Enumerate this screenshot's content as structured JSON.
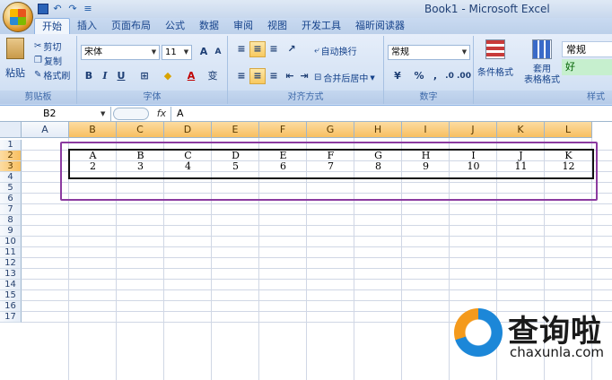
{
  "window": {
    "title": "Book1 - Microsoft Excel"
  },
  "qat": {
    "undo_glyph": "↶",
    "redo_glyph": "↷",
    "customize_glyph": "≡"
  },
  "tabs": [
    {
      "label": "开始",
      "active": true
    },
    {
      "label": "插入"
    },
    {
      "label": "页面布局"
    },
    {
      "label": "公式"
    },
    {
      "label": "数据"
    },
    {
      "label": "审阅"
    },
    {
      "label": "视图"
    },
    {
      "label": "开发工具"
    },
    {
      "label": "福昕阅读器"
    }
  ],
  "ribbon": {
    "clipboard": {
      "label": "剪贴板",
      "paste": "粘贴",
      "cut": "剪切",
      "copy": "复制",
      "format_painter": "格式刷"
    },
    "font": {
      "label": "字体",
      "name": "宋体",
      "size": "11",
      "bold": "B",
      "italic": "I",
      "underline": "U",
      "grow": "A",
      "shrink": "A",
      "font_color": "A",
      "phonetic": "变"
    },
    "alignment": {
      "label": "对齐方式",
      "wrap_text": "自动换行",
      "merge_center": "合并后居中"
    },
    "number": {
      "label": "数字",
      "format": "常规",
      "percent": "%",
      "comma": ","
    },
    "styles": {
      "label": "样式",
      "conditional_format": "条件格式",
      "format_as_table": "套用\n表格格式",
      "style_normal": "常规",
      "style_good": "好"
    }
  },
  "formula_bar": {
    "name_box": "B2",
    "fx": "fx",
    "value": "A"
  },
  "grid": {
    "columns": [
      "A",
      "B",
      "C",
      "D",
      "E",
      "F",
      "G",
      "H",
      "I",
      "J",
      "K",
      "L"
    ],
    "highlighted_columns": [
      "B",
      "C",
      "D",
      "E",
      "F",
      "G",
      "H",
      "I",
      "J",
      "K",
      "L"
    ],
    "rows": [
      "1",
      "2",
      "3",
      "4",
      "5",
      "6",
      "7",
      "8",
      "9",
      "10",
      "11",
      "12",
      "13",
      "14",
      "15",
      "16",
      "17"
    ],
    "highlighted_rows": [
      "2",
      "3"
    ],
    "row2": [
      "A",
      "B",
      "C",
      "D",
      "E",
      "F",
      "G",
      "H",
      "I",
      "J",
      "K"
    ],
    "row3": [
      "2",
      "3",
      "4",
      "5",
      "6",
      "7",
      "8",
      "9",
      "10",
      "11",
      "12"
    ]
  },
  "watermark": {
    "brand": "查询啦",
    "url": "chaxunla.com"
  },
  "colors": {
    "selection_box": "#8b3aa0",
    "header_highlight": "#f8bf60",
    "ribbon_bg": "#d7e4f5"
  }
}
